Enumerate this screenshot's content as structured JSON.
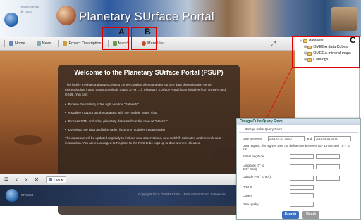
{
  "banner": {
    "title": "Planetary SUrface Portal",
    "logo_text": "observatoire de paris"
  },
  "toolbar": {
    "items": [
      {
        "label": "Home",
        "icon": "home-icon"
      },
      {
        "label": "News",
        "icon": "news-icon"
      },
      {
        "label": "Project Description",
        "icon": "edit-icon"
      },
      {
        "label": "MarsSI",
        "icon": "marssi-icon"
      },
      {
        "label": "Mars Visu",
        "icon": "mars-visu-icon"
      }
    ]
  },
  "annotations": {
    "a": "A",
    "b": "B",
    "c": "C"
  },
  "welcome": {
    "title": "Welcome to the Planetary SUrface Portal (PSUP)",
    "intro": "This facility involves a data processing center coupled with planetary surface data dissemination center (mineralogical maps, geomorphologic maps, DTM, ...). Planetary SUrface Portal is an initiative from OSUPS and OSUL. You can:",
    "bullets": [
      "Browse the catalog in the right window \"datasets\"",
      "Visualize in 2D or 3D the datasets with the module \"Mars Visu\"",
      "Process DTM and other planetary datasets from the module \"MarsSI\"",
      "Download the data and information from any modules (     Downloads)"
    ],
    "footer": "The database will be updated regularly to include new observations, new redshift estimates and new relevant information. You are encouraged to Register to the RSS     to be kept up to date on new releases."
  },
  "navbar": {
    "menu_icon": "≡",
    "back_icon": "‹",
    "forward_icon": "›",
    "close_icon": "✕",
    "home_label": "Home"
  },
  "footer": {
    "copyright": "Copyright 2015 OSUPS/OSUL - Built with SITools2 framework",
    "logo_text": "SITools2"
  },
  "tree": {
    "root": "datasets",
    "children": [
      "OMEGA data Cubes",
      "OMEGA mineral maps",
      "Catalogs"
    ]
  },
  "query_form": {
    "window_title": "Omega Cube Query Form",
    "section_title": "Omega Cube Query Form",
    "date_label": "Date Between",
    "date_start": "2001-01-01 00:00",
    "date_and": "and",
    "date_end": "2015-01-01 00:00",
    "note": "Data request : for a given time TS, define time between TS - 15 min and TS + 10 min",
    "fields": [
      "Solar Longitude",
      "Longitude (0° to 360° East)",
      "Latitude (-90° to 90°)",
      "Orbit #",
      "Cube #",
      "Data quality"
    ],
    "search_label": "Search",
    "reset_label": "Reset"
  },
  "colors": {
    "annotation": "#e00000",
    "search_button": "#3d6fbf",
    "reset_button": "#9a9a9a"
  }
}
